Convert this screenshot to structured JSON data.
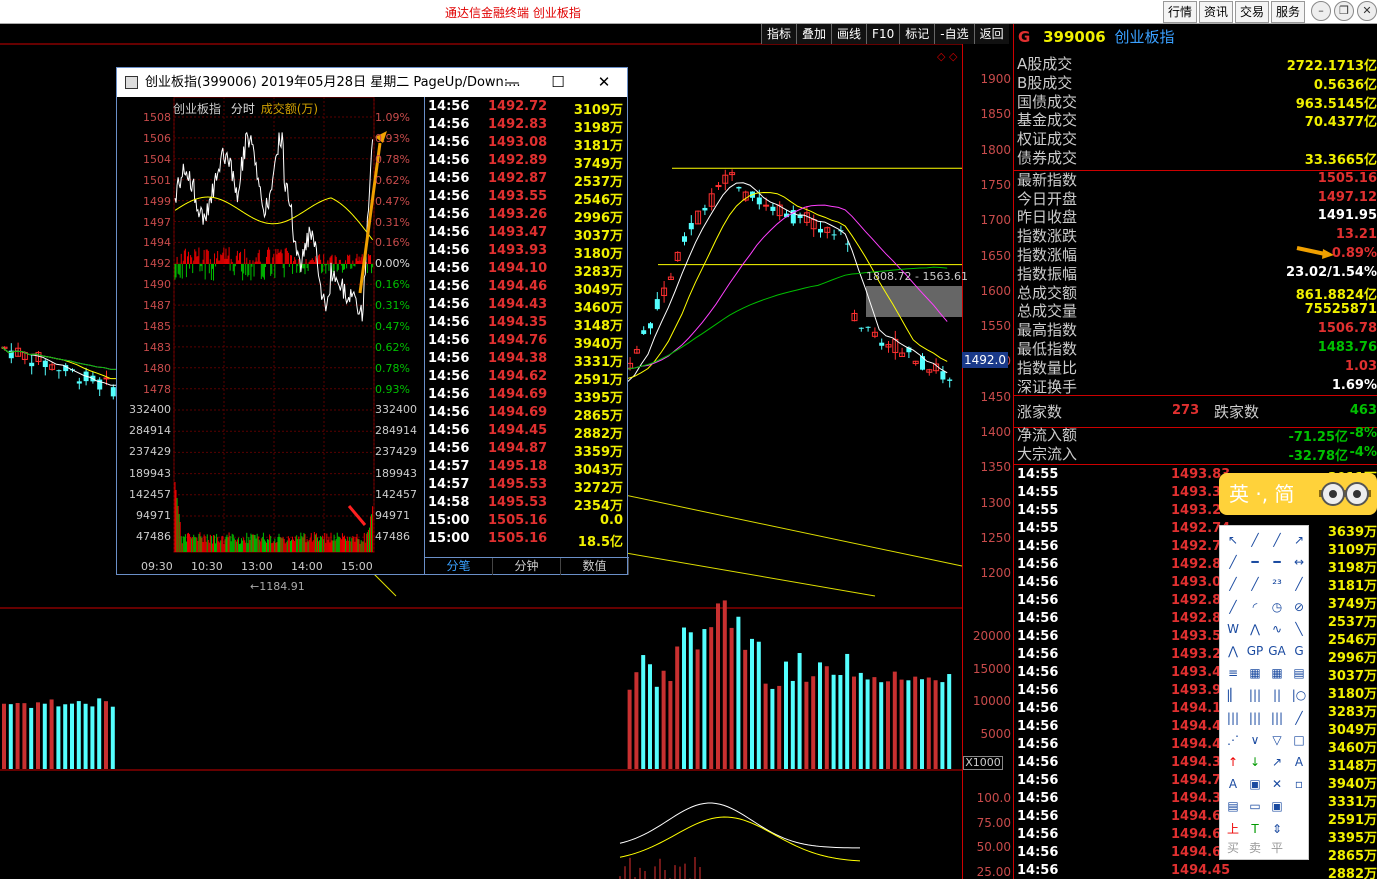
{
  "app": {
    "title": "通达信金融终端   创业板指"
  },
  "top_buttons": [
    "行情",
    "资讯",
    "交易",
    "服务"
  ],
  "toolbar": [
    "指标",
    "叠加",
    "画线",
    "F10",
    "标记",
    "-自选",
    "返回"
  ],
  "price_axis": [
    "1900",
    "1850",
    "1800",
    "1750",
    "1700",
    "1650",
    "1600",
    "1550",
    "1500",
    "1450",
    "1400",
    "1350",
    "1300",
    "1250",
    "1200"
  ],
  "current_price_label": "1492.0",
  "range_label": "1808.72 - 1563.61",
  "low_label": "1184.91",
  "volume_axis": [
    "20000",
    "15000",
    "10000",
    "5000"
  ],
  "volume_unit": "X1000",
  "indicator_axis": [
    "100.0",
    "75.00",
    "50.00",
    "25.00"
  ],
  "popup": {
    "title": "创业板指(399006) 2019年05月28日 星期二 PageUp/Down:...",
    "chart_title": "创业板指",
    "chart_mode": "分时",
    "chart_metric": "成交额(万)",
    "left_prices": [
      "1508",
      "1506",
      "1504",
      "1501",
      "1499",
      "1497",
      "1494",
      "1492",
      "1490",
      "1487",
      "1485",
      "1483",
      "1480",
      "1478"
    ],
    "right_pcts": [
      "1.09%",
      "0.93%",
      "0.78%",
      "0.62%",
      "0.47%",
      "0.31%",
      "0.16%",
      "0.00%",
      "0.16%",
      "0.31%",
      "0.47%",
      "0.62%",
      "0.78%",
      "0.93%"
    ],
    "vol_labels": [
      "332400",
      "284914",
      "237429",
      "189943",
      "142457",
      "94971",
      "47486"
    ],
    "time_labels": [
      "09:30",
      "10:30",
      "13:00",
      "14:00",
      "15:00"
    ],
    "ticks": [
      {
        "t": "14:56",
        "p": "1492.72",
        "v": "3109万"
      },
      {
        "t": "14:56",
        "p": "1492.83",
        "v": "3198万"
      },
      {
        "t": "14:56",
        "p": "1493.08",
        "v": "3181万"
      },
      {
        "t": "14:56",
        "p": "1492.89",
        "v": "3749万"
      },
      {
        "t": "14:56",
        "p": "1492.87",
        "v": "2537万"
      },
      {
        "t": "14:56",
        "p": "1493.55",
        "v": "2546万"
      },
      {
        "t": "14:56",
        "p": "1493.26",
        "v": "2996万"
      },
      {
        "t": "14:56",
        "p": "1493.47",
        "v": "3037万"
      },
      {
        "t": "14:56",
        "p": "1493.93",
        "v": "3180万"
      },
      {
        "t": "14:56",
        "p": "1494.10",
        "v": "3283万"
      },
      {
        "t": "14:56",
        "p": "1494.46",
        "v": "3049万"
      },
      {
        "t": "14:56",
        "p": "1494.43",
        "v": "3460万"
      },
      {
        "t": "14:56",
        "p": "1494.35",
        "v": "3148万"
      },
      {
        "t": "14:56",
        "p": "1494.76",
        "v": "3940万"
      },
      {
        "t": "14:56",
        "p": "1494.38",
        "v": "3331万"
      },
      {
        "t": "14:56",
        "p": "1494.62",
        "v": "2591万"
      },
      {
        "t": "14:56",
        "p": "1494.69",
        "v": "3395万"
      },
      {
        "t": "14:56",
        "p": "1494.69",
        "v": "2865万"
      },
      {
        "t": "14:56",
        "p": "1494.45",
        "v": "2882万"
      },
      {
        "t": "14:56",
        "p": "1494.87",
        "v": "3359万"
      },
      {
        "t": "14:57",
        "p": "1495.18",
        "v": "3043万"
      },
      {
        "t": "14:57",
        "p": "1495.53",
        "v": "3272万"
      },
      {
        "t": "14:58",
        "p": "1495.53",
        "v": "2354万"
      },
      {
        "t": "15:00",
        "p": "1505.16",
        "v": "0.0"
      },
      {
        "t": "15:00",
        "p": "1505.16",
        "v": "18.5亿"
      }
    ],
    "tabs": [
      "分笔",
      "分钟",
      "数值"
    ]
  },
  "right_panel": {
    "marker": "G",
    "code": "399006",
    "name": "创业板指",
    "stats": [
      {
        "l": "A股成交",
        "v": "2722.1713亿",
        "c": "#f0f000"
      },
      {
        "l": "B股成交",
        "v": "0.5636亿",
        "c": "#f0f000"
      },
      {
        "l": "国债成交",
        "v": "963.5145亿",
        "c": "#f0f000"
      },
      {
        "l": "基金成交",
        "v": "70.4377亿",
        "c": "#f0f000"
      },
      {
        "l": "权证成交",
        "v": "",
        "c": "#f0f000"
      },
      {
        "l": "债券成交",
        "v": "33.3665亿",
        "c": "#f0f000"
      },
      {
        "l": "最新指数",
        "v": "1505.16",
        "c": "#e03030"
      },
      {
        "l": "今日开盘",
        "v": "1497.12",
        "c": "#e03030"
      },
      {
        "l": "昨日收盘",
        "v": "1491.95",
        "c": "#ffffff"
      },
      {
        "l": "指数涨跌",
        "v": "13.21",
        "c": "#e03030"
      },
      {
        "l": "指数涨幅",
        "v": "0.89%",
        "c": "#e03030"
      },
      {
        "l": "指数振幅",
        "v": "23.02/1.54%",
        "c": "#ffffff"
      },
      {
        "l": "总成交额",
        "v": "861.8824亿",
        "c": "#f0f000"
      },
      {
        "l": "总成交量",
        "v": "75525871",
        "c": "#f0f000"
      },
      {
        "l": "最高指数",
        "v": "1506.78",
        "c": "#e03030"
      },
      {
        "l": "最低指数",
        "v": "1483.76",
        "c": "#00c000"
      },
      {
        "l": "指数量比",
        "v": "1.03",
        "c": "#e03030"
      },
      {
        "l": "深证换手",
        "v": "1.69%",
        "c": "#ffffff"
      }
    ],
    "up_label": "涨家数",
    "up_count": "273",
    "down_label": "跌家数",
    "down_count": "463",
    "flows": [
      {
        "l": "净流入额",
        "v": "-71.25亿",
        "p": "-8%"
      },
      {
        "l": "大宗流入",
        "v": "-32.78亿",
        "p": "-4%"
      }
    ],
    "ticks": [
      {
        "t": "14:55",
        "p": "1493.83",
        "v": "3011万"
      },
      {
        "t": "14:55",
        "p": "1493.34",
        "v": ""
      },
      {
        "t": "14:55",
        "p": "1493.27",
        "v": ""
      },
      {
        "t": "14:55",
        "p": "1492.74",
        "v": "3639万"
      },
      {
        "t": "14:56",
        "p": "1492.72",
        "v": "3109万"
      },
      {
        "t": "14:56",
        "p": "1492.83",
        "v": "3198万"
      },
      {
        "t": "14:56",
        "p": "1493.08",
        "v": "3181万"
      },
      {
        "t": "14:56",
        "p": "1492.89",
        "v": "3749万"
      },
      {
        "t": "14:56",
        "p": "1492.87",
        "v": "2537万"
      },
      {
        "t": "14:56",
        "p": "1493.55",
        "v": "2546万"
      },
      {
        "t": "14:56",
        "p": "1493.26",
        "v": "2996万"
      },
      {
        "t": "14:56",
        "p": "1493.47",
        "v": "3037万"
      },
      {
        "t": "14:56",
        "p": "1493.93",
        "v": "3180万"
      },
      {
        "t": "14:56",
        "p": "1494.10",
        "v": "3283万"
      },
      {
        "t": "14:56",
        "p": "1494.46",
        "v": "3049万"
      },
      {
        "t": "14:56",
        "p": "1494.43",
        "v": "3460万"
      },
      {
        "t": "14:56",
        "p": "1494.35",
        "v": "3148万"
      },
      {
        "t": "14:56",
        "p": "1494.76",
        "v": "3940万"
      },
      {
        "t": "14:56",
        "p": "1494.38",
        "v": "3331万"
      },
      {
        "t": "14:56",
        "p": "1494.62",
        "v": "2591万"
      },
      {
        "t": "14:56",
        "p": "1494.69",
        "v": "3395万"
      },
      {
        "t": "14:56",
        "p": "1494.69",
        "v": "2865万"
      },
      {
        "t": "14:56",
        "p": "1494.45",
        "v": "2882万"
      }
    ]
  },
  "ime": {
    "text": "英 ·, 简"
  },
  "draw_tools_footer": [
    "买",
    "卖",
    "平"
  ]
}
